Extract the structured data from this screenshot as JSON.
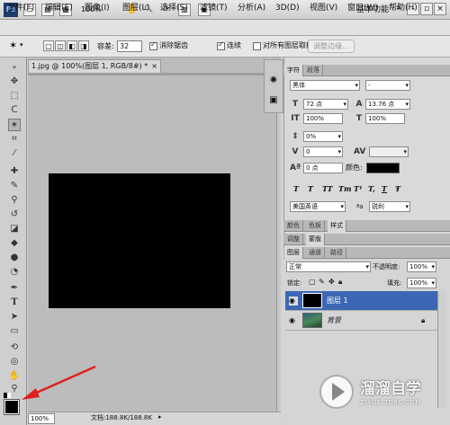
{
  "topbar": {
    "logo": "Ps",
    "zoom": "100%",
    "workspace": "基本功能"
  },
  "menu": [
    "文件(F)",
    "编辑(E)",
    "图像(I)",
    "图层(L)",
    "选择(S)",
    "滤镜(T)",
    "分析(A)",
    "3D(D)",
    "视图(V)",
    "窗口(W)",
    "帮助(H)"
  ],
  "options": {
    "tolerance_label": "容差:",
    "tolerance_value": "32",
    "antialias_label": "消除锯齿",
    "contiguous_label": "连续",
    "sample_all_label": "对所有图层取样",
    "refine_edge_label": "调整边缘..."
  },
  "document": {
    "tab_title": "1.jpg @ 100%(图层 1, RGB/8#) *",
    "tab_close": "×",
    "canvas_color": "#000000",
    "zoom": "100%",
    "doc_info": "文档:188.8K/188.8K"
  },
  "char_panel": {
    "tabs": [
      "字符",
      "段落"
    ],
    "font_family": "黑体",
    "font_style": "-",
    "font_size": "72 点",
    "leading": "13.76 点",
    "vertical_scale": "100%",
    "horizontal_scale": "100%",
    "tsume": "0%",
    "kerning": "0",
    "baseline": "0 点",
    "color_label": "颜色:",
    "color_value": "#000000",
    "style_buttons": [
      "T",
      "T",
      "TT",
      "Tт",
      "T¹",
      "T,",
      "T",
      "Ŧ"
    ],
    "language": "美国英语",
    "aa_prefix": "ªa",
    "antialias": "锐利"
  },
  "panel_tabs_mid": [
    "颜色",
    "色板",
    "样式"
  ],
  "panel_tabs_adj": [
    "调整",
    "蒙版"
  ],
  "layers_panel": {
    "tabs": [
      "图层",
      "通道",
      "路径"
    ],
    "blend_mode": "正常",
    "opacity_label": "不透明度:",
    "opacity_value": "100%",
    "lock_label": "锁定:",
    "fill_label": "填充:",
    "fill_value": "100%",
    "layers": [
      {
        "name": "图层 1",
        "selected": true
      },
      {
        "name": "背景",
        "selected": false
      }
    ]
  },
  "watermark": {
    "title": "溜溜自学",
    "subtitle": "ZIXUE.3D66.COM"
  },
  "colors": {
    "selected_layer": "#3d67b4",
    "arrow": "#e02020"
  }
}
